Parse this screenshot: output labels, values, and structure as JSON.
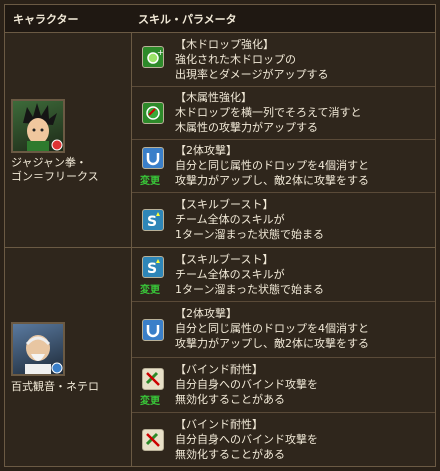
{
  "header": {
    "col_character": "キャラクター",
    "col_skill": "スキル・パラメータ"
  },
  "characters": [
    {
      "name_lines": [
        "ジャジャン拳・",
        "ゴン＝フリークス"
      ],
      "skills": [
        {
          "icon": "wood-drop-enhance-icon",
          "change": "",
          "lines": [
            "【木ドロップ強化】",
            "強化された木ドロップの",
            "出現率とダメージがアップする"
          ]
        },
        {
          "icon": "wood-attribute-enhance-icon",
          "change": "",
          "lines": [
            "【木属性強化】",
            "木ドロップを横一列でそろえて消すと",
            "木属性の攻撃力がアップする"
          ]
        },
        {
          "icon": "two-body-attack-icon",
          "change": "変更",
          "lines": [
            "【2体攻撃】",
            "自分と同じ属性のドロップを4個消すと",
            "攻撃力がアップし、敵2体に攻撃をする"
          ]
        },
        {
          "icon": "skill-boost-icon",
          "change": "",
          "lines": [
            "【スキルブースト】",
            "チーム全体のスキルが",
            "1ターン溜まった状態で始まる"
          ]
        }
      ]
    },
    {
      "name_lines": [
        "百式観音・ネテロ"
      ],
      "skills": [
        {
          "icon": "skill-boost-icon",
          "change": "変更",
          "lines": [
            "【スキルブースト】",
            "チーム全体のスキルが",
            "1ターン溜まった状態で始まる"
          ]
        },
        {
          "icon": "two-body-attack-icon",
          "change": "",
          "lines": [
            "【2体攻撃】",
            "自分と同じ属性のドロップを4個消すと",
            "攻撃力がアップし、敵2体に攻撃をする"
          ]
        },
        {
          "icon": "bind-resist-icon",
          "change": "変更",
          "lines": [
            "【バインド耐性】",
            "自分自身へのバインド攻撃を",
            "無効化することがある"
          ]
        },
        {
          "icon": "bind-resist-icon",
          "change": "",
          "lines": [
            "【バインド耐性】",
            "自分自身へのバインド攻撃を",
            "無効化することがある"
          ]
        }
      ]
    }
  ]
}
